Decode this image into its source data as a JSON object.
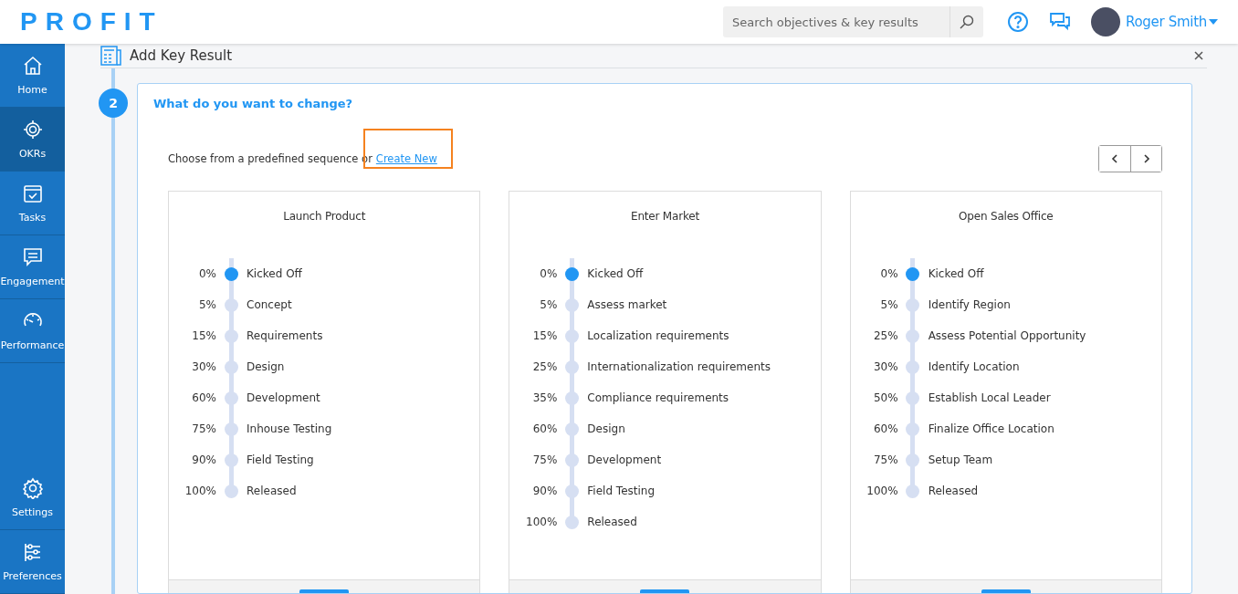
{
  "brand": "PROFIT",
  "search": {
    "placeholder": "Search objectives & key results"
  },
  "user": {
    "name": "Roger Smith"
  },
  "sidebar": {
    "items": [
      {
        "label": "Home",
        "selected": false
      },
      {
        "label": "OKRs",
        "selected": true
      },
      {
        "label": "Tasks",
        "selected": false
      },
      {
        "label": "Engagement",
        "selected": false
      },
      {
        "label": "Performance",
        "selected": false
      }
    ],
    "bottom_items": [
      {
        "label": "Settings",
        "selected": false
      },
      {
        "label": "Preferences",
        "selected": false
      }
    ]
  },
  "dialog": {
    "title": "Add Key Result",
    "step": {
      "number": "2",
      "title": "What do you want to change?"
    },
    "intro": "Choose from a predefined sequence or",
    "link": "Create New",
    "sequences": [
      {
        "title": "Launch Product",
        "steps": [
          {
            "percent": "0%",
            "label": "Kicked Off",
            "active": true
          },
          {
            "percent": "5%",
            "label": "Concept",
            "active": false
          },
          {
            "percent": "15%",
            "label": "Requirements",
            "active": false
          },
          {
            "percent": "30%",
            "label": "Design",
            "active": false
          },
          {
            "percent": "60%",
            "label": "Development",
            "active": false
          },
          {
            "percent": "75%",
            "label": "Inhouse Testing",
            "active": false
          },
          {
            "percent": "90%",
            "label": "Field Testing",
            "active": false
          },
          {
            "percent": "100%",
            "label": "Released",
            "active": false
          }
        ]
      },
      {
        "title": "Enter Market",
        "steps": [
          {
            "percent": "0%",
            "label": "Kicked Off",
            "active": true
          },
          {
            "percent": "5%",
            "label": "Assess market",
            "active": false
          },
          {
            "percent": "15%",
            "label": "Localization requirements",
            "active": false
          },
          {
            "percent": "25%",
            "label": "Internationalization requirements",
            "active": false
          },
          {
            "percent": "35%",
            "label": "Compliance requirements",
            "active": false
          },
          {
            "percent": "60%",
            "label": "Design",
            "active": false
          },
          {
            "percent": "75%",
            "label": "Development",
            "active": false
          },
          {
            "percent": "90%",
            "label": "Field Testing",
            "active": false
          },
          {
            "percent": "100%",
            "label": "Released",
            "active": false
          }
        ]
      },
      {
        "title": "Open Sales Office",
        "steps": [
          {
            "percent": "0%",
            "label": "Kicked Off",
            "active": true
          },
          {
            "percent": "5%",
            "label": "Identify Region",
            "active": false
          },
          {
            "percent": "25%",
            "label": "Assess Potential Opportunity",
            "active": false
          },
          {
            "percent": "30%",
            "label": "Identify Location",
            "active": false
          },
          {
            "percent": "50%",
            "label": "Establish Local Leader",
            "active": false
          },
          {
            "percent": "60%",
            "label": "Finalize Office Location",
            "active": false
          },
          {
            "percent": "75%",
            "label": "Setup Team",
            "active": false
          },
          {
            "percent": "100%",
            "label": "Released",
            "active": false
          }
        ]
      }
    ]
  }
}
